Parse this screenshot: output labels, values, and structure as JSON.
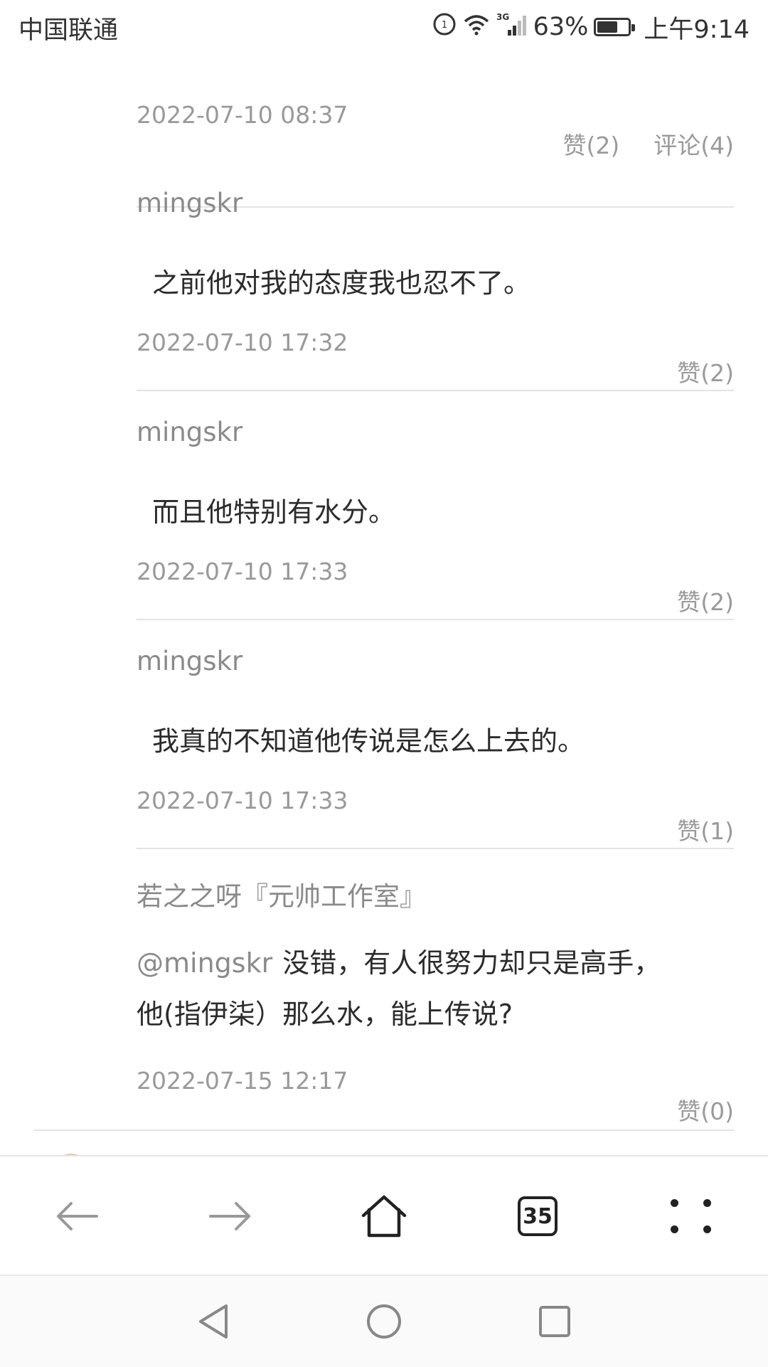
{
  "status_bar": {
    "carrier": "中国联通",
    "network": "3G",
    "battery_percent": "63%",
    "battery_level": 0.63,
    "time": "上午9:14"
  },
  "first_entry": {
    "time": "2022-07-10 08:37",
    "like_label": "赞(2)",
    "comment_label": "评论(4)"
  },
  "replies": [
    {
      "author": "mingskr",
      "text": "之前他对我的态度我也忍不了。",
      "time": "2022-07-10 17:32",
      "like_label": "赞(2)"
    },
    {
      "author": "mingskr",
      "text": "而且他特别有水分。",
      "time": "2022-07-10 17:33",
      "like_label": "赞(2)"
    },
    {
      "author": "mingskr",
      "text": "我真的不知道他传说是怎么上去的。",
      "time": "2022-07-10 17:33",
      "like_label": "赞(1)"
    },
    {
      "author": "若之之呀『元帅工作室』",
      "mention": "@mingskr",
      "text_line1": "没错，有人很努力却只是高手，",
      "text_line2": "他(指伊柒）那么水，能上传说?",
      "time": "2022-07-15 12:17",
      "like_label": "赞(0)"
    }
  ],
  "toolbar": {
    "back_icon": "arrow-left-icon",
    "forward_icon": "arrow-right-icon",
    "home_icon": "home-icon",
    "tab_count": "35",
    "menu_icon": "four-dots-menu-icon"
  },
  "navbar": {
    "back_icon": "triangle-back-icon",
    "home_icon": "circle-home-icon",
    "recents_icon": "square-recents-icon"
  }
}
